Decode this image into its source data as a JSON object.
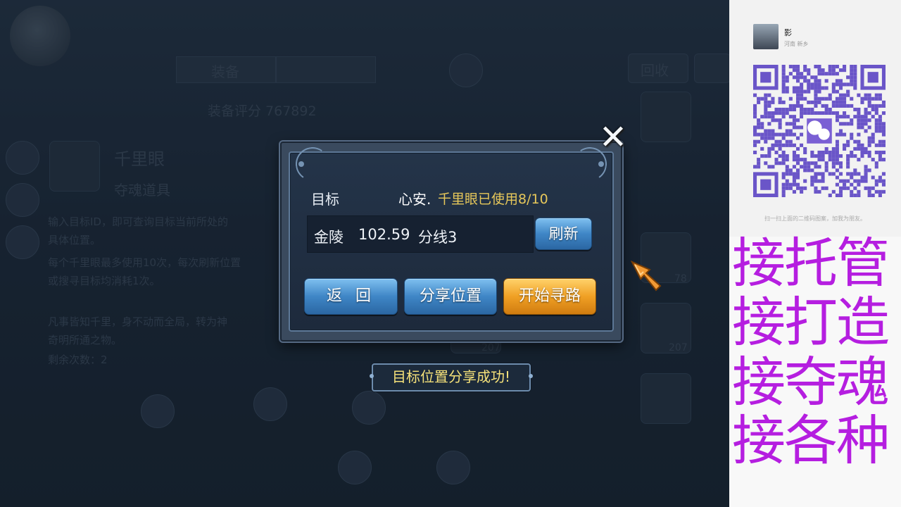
{
  "background": {
    "score_label": "装备评分 767892",
    "item_name": "千里眼",
    "item_type": "夺魂道具",
    "button_recycle": "回收",
    "tab_label": "装备",
    "desc_lines": [
      "输入目标ID，即可查询目标当前所处的",
      "具体位置。",
      "每个千里眼最多使用10次，每次刷新位置",
      "或搜寻目标均消耗1次。",
      "",
      "凡事皆知千里，身不动而全局，转为神",
      "奇明所通之物。",
      "剩余次数：2"
    ],
    "slot_counts": [
      "78",
      "207",
      "207"
    ]
  },
  "dialog": {
    "target_label": "目标",
    "target_name": "心安.",
    "usage_text": "千里眼已使用8/10",
    "location": {
      "city": "金陵",
      "coords": "102.59",
      "line": "分线3"
    },
    "refresh_label": "刷新",
    "back_label": "返 回",
    "share_label": "分享位置",
    "start_label": "开始寻路",
    "close_icon": "close-icon"
  },
  "toast": {
    "message": "目标位置分享成功!"
  },
  "side_panel": {
    "profile_name": "影",
    "profile_location": "河南 新乡",
    "qr_hint": "扫一扫上面的二维码图案，加我为朋友。",
    "ad_lines": [
      "接托管",
      "接打造",
      "接夺魂",
      "接各种"
    ],
    "ad_color": "#b51ee0"
  }
}
